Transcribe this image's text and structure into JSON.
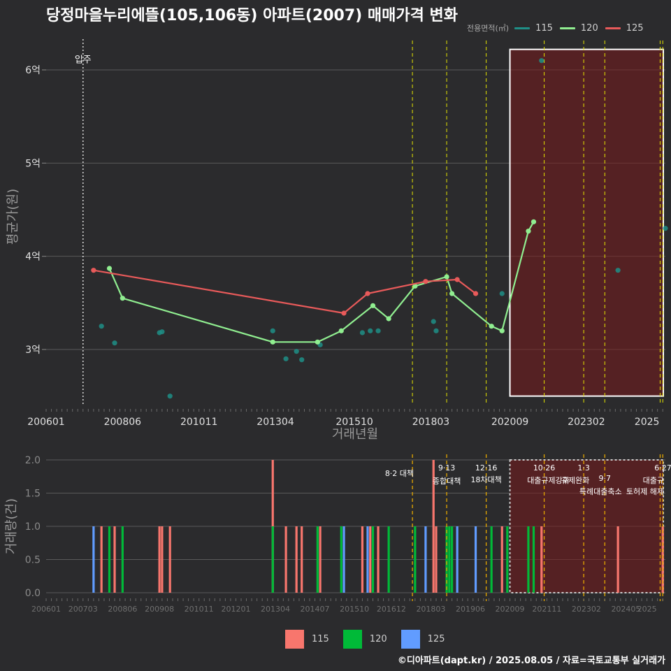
{
  "title": "당정마을누리에뜰(105,106동) 아파트(2007) 매매가격 변화",
  "caption": "©디아파트(dapt.kr) / 2025.08.05 / 자료=국토교통부 실거래가",
  "legend_title": "전용면적(㎡)",
  "colors": {
    "s115": "#1f8f87",
    "s120": "#90ee90",
    "s125": "#e85a5a",
    "b115": "#f8766d",
    "b120": "#00ba38",
    "b125": "#619cff",
    "policy_line": "#e6e600",
    "policy_line_bottom": "#e6a800"
  },
  "chart_data": [
    {
      "type": "line",
      "xlabel": "거래년월",
      "ylabel": "평균가(원)",
      "y_ticks": [
        "3억",
        "4억",
        "5억",
        "6억"
      ],
      "x_ticks": [
        "200601",
        "200806",
        "201011",
        "201304",
        "201510",
        "201803",
        "202009",
        "202302",
        "2025"
      ],
      "ylim": [
        2.4,
        6.45
      ],
      "xlim": [
        "2006-01",
        "2025-08"
      ],
      "move_in_label": "입주",
      "move_in_date": "2007-03",
      "highlight_period": [
        "2020-09",
        "2025-08"
      ],
      "policy_dates": [
        "2017-08",
        "2018-09",
        "2019-12",
        "2021-10",
        "2023-01",
        "2023-09",
        "2025-06",
        "2025-07"
      ],
      "series": [
        {
          "name": "115",
          "type": "scatter",
          "points": [
            [
              "2007-10",
              3.25
            ],
            [
              "2008-03",
              3.07
            ],
            [
              "2009-08",
              3.18
            ],
            [
              "2009-09",
              3.19
            ],
            [
              "2009-12",
              2.5
            ],
            [
              "2013-03",
              3.2
            ],
            [
              "2013-08",
              2.9
            ],
            [
              "2013-12",
              2.98
            ],
            [
              "2014-02",
              2.89
            ],
            [
              "2014-09",
              3.05
            ],
            [
              "2016-01",
              3.18
            ],
            [
              "2016-04",
              3.2
            ],
            [
              "2016-07",
              3.2
            ],
            [
              "2018-04",
              3.3
            ],
            [
              "2018-05",
              3.2
            ],
            [
              "2020-06",
              3.6
            ],
            [
              "2021-09",
              6.1
            ],
            [
              "2024-02",
              3.85
            ],
            [
              "2025-08",
              4.3
            ]
          ]
        },
        {
          "name": "120",
          "type": "line",
          "points": [
            [
              "2008-01",
              3.87
            ],
            [
              "2008-06",
              3.55
            ],
            [
              "2013-03",
              3.08
            ],
            [
              "2014-08",
              3.08
            ],
            [
              "2015-05",
              3.2
            ],
            [
              "2016-05",
              3.47
            ],
            [
              "2016-11",
              3.33
            ],
            [
              "2017-09",
              3.68
            ],
            [
              "2018-09",
              3.78
            ],
            [
              "2018-11",
              3.6
            ],
            [
              "2020-02",
              3.25
            ],
            [
              "2020-06",
              3.2
            ],
            [
              "2021-04",
              4.27
            ],
            [
              "2021-06",
              4.37
            ]
          ]
        },
        {
          "name": "125",
          "type": "line",
          "points": [
            [
              "2007-07",
              3.85
            ],
            [
              "2015-06",
              3.39
            ],
            [
              "2016-03",
              3.6
            ],
            [
              "2018-01",
              3.73
            ],
            [
              "2019-01",
              3.75
            ],
            [
              "2019-08",
              3.6
            ]
          ]
        }
      ]
    },
    {
      "type": "bar",
      "ylabel": "거래량(건)",
      "y_ticks": [
        "0.0",
        "0.5",
        "1.0",
        "1.5",
        "2.0"
      ],
      "x_ticks": [
        "200601",
        "200703",
        "200806",
        "200908",
        "201011",
        "201201",
        "201304",
        "201407",
        "201510",
        "201612",
        "201803",
        "201906",
        "202009",
        "202111",
        "202302",
        "202405",
        "2025"
      ],
      "ylim": [
        0,
        2.1
      ],
      "policy_labels": [
        {
          "date": "2017-08",
          "line1": "8·2 대책",
          "line2": ""
        },
        {
          "date": "2018-09",
          "line1": "9·13",
          "line2": "종합대책"
        },
        {
          "date": "2019-12",
          "line1": "12·16",
          "line2": "18차대책"
        },
        {
          "date": "2021-10",
          "line1": "10·26",
          "line2": "대출규제강화"
        },
        {
          "date": "2023-01",
          "line1": "1·3",
          "line2": "규제완화"
        },
        {
          "date": "2023-09",
          "line1": "9·7",
          "line2": "특례대출축소"
        },
        {
          "date": "2025-06",
          "line1": "6·27",
          "line2": "대출규"
        },
        {
          "date": "2025-07",
          "line1": "",
          "line2": "토허제 해제"
        }
      ],
      "series": [
        {
          "name": "115",
          "bars": [
            [
              "2007-10",
              1
            ],
            [
              "2008-03",
              1
            ],
            [
              "2009-08",
              1
            ],
            [
              "2009-09",
              1
            ],
            [
              "2009-12",
              1
            ],
            [
              "2013-03",
              2
            ],
            [
              "2013-08",
              1
            ],
            [
              "2013-12",
              1
            ],
            [
              "2014-02",
              1
            ],
            [
              "2014-09",
              1
            ],
            [
              "2016-01",
              1
            ],
            [
              "2016-04",
              1
            ],
            [
              "2016-07",
              1
            ],
            [
              "2018-04",
              2
            ],
            [
              "2018-05",
              1
            ],
            [
              "2020-06",
              1
            ],
            [
              "2021-09",
              1
            ],
            [
              "2024-02",
              1
            ],
            [
              "2025-07",
              1
            ]
          ]
        },
        {
          "name": "120",
          "bars": [
            [
              "2008-01",
              1
            ],
            [
              "2008-06",
              1
            ],
            [
              "2013-03",
              1
            ],
            [
              "2014-08",
              1
            ],
            [
              "2015-05",
              1
            ],
            [
              "2016-05",
              1
            ],
            [
              "2016-11",
              1
            ],
            [
              "2017-09",
              1
            ],
            [
              "2018-09",
              1
            ],
            [
              "2018-10",
              1
            ],
            [
              "2018-11",
              1
            ],
            [
              "2020-02",
              1
            ],
            [
              "2020-08",
              1
            ],
            [
              "2021-04",
              1
            ],
            [
              "2021-06",
              1
            ]
          ]
        },
        {
          "name": "125",
          "bars": [
            [
              "2007-07",
              1
            ],
            [
              "2015-06",
              1
            ],
            [
              "2016-03",
              1
            ],
            [
              "2018-01",
              1
            ],
            [
              "2019-01",
              1
            ],
            [
              "2019-08",
              1
            ]
          ]
        }
      ]
    }
  ]
}
